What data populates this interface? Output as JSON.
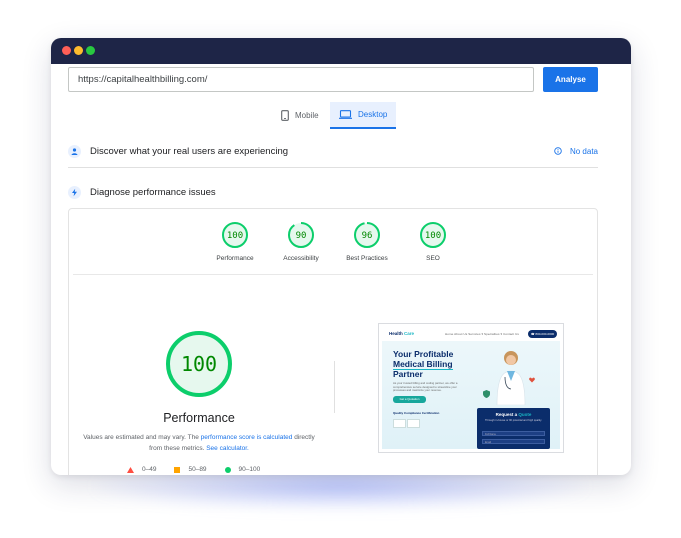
{
  "url_bar": {
    "value": "https://capitalhealthbilling.com/",
    "analyse_label": "Analyse"
  },
  "tabs": [
    {
      "label": "Mobile",
      "icon": "smartphone-icon",
      "selected": false
    },
    {
      "label": "Desktop",
      "icon": "laptop-icon",
      "selected": true
    }
  ],
  "discover": {
    "label": "Discover what your real users are experiencing",
    "no_data": "No data"
  },
  "diagnose": {
    "label": "Diagnose performance issues"
  },
  "scores": [
    {
      "label": "Performance",
      "value": 100
    },
    {
      "label": "Accessibility",
      "value": 90
    },
    {
      "label": "Best Practices",
      "value": 96
    },
    {
      "label": "SEO",
      "value": 100
    }
  ],
  "main_score": {
    "value": 100,
    "label": "Performance"
  },
  "note": {
    "part1": "Values are estimated and may vary. The ",
    "link1": "performance score is calculated",
    "part2": " directly from these metrics. ",
    "link2": "See calculator."
  },
  "legend": [
    {
      "range": "0–49",
      "color": "#ff4e42",
      "shape": "triangle"
    },
    {
      "range": "50–89",
      "color": "#ffa400",
      "shape": "square"
    },
    {
      "range": "90–100",
      "color": "#0cce6b",
      "shape": "circle"
    }
  ],
  "colors": {
    "accent": "#1a73e8",
    "pass": "#0cce6b",
    "pass_text": "#008800",
    "titlebar": "#1e2547"
  },
  "thumbnail": {
    "logo_a": "Health",
    "logo_b": "Care",
    "nav_links": "Home   About Us   Services ▾   Specialties ▾   Contact Us",
    "call_label": "☎ 800-000-0000",
    "headline_1": "Your Profitable",
    "headline_2": "Medical Billing",
    "headline_3": "Partner",
    "body": "As your trusted billing and coding partner, we offer a comprehensive service designed to streamline your processes and maximize your revenue.",
    "cta": "Get a Quotation",
    "qualification": "Quality Compliance Certification",
    "quote_title_a": "Request a",
    "quote_title_b": "Quote",
    "quote_sub": "Through in-house or 90 potential and high quality.",
    "field_1": "Full Name",
    "field_2": "Email"
  }
}
